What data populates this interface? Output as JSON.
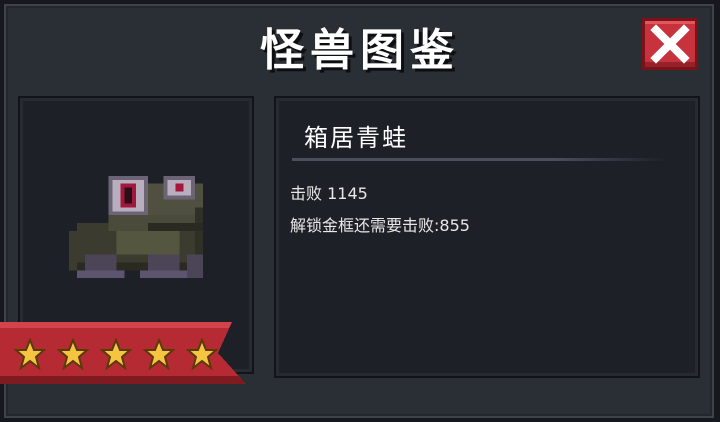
{
  "title": "怪兽图鉴",
  "icons": {
    "close": "close-icon",
    "star": "star-icon",
    "monster": "frog-sprite"
  },
  "monster": {
    "name": "箱居青蛙",
    "defeated_label": "击败",
    "defeated_count": "1145",
    "defeated_text": "击败 1145",
    "unlock_text": "解锁金框还需要击败:855",
    "stars": 5
  },
  "colors": {
    "close_red": "#c8323c",
    "ribbon_red": "#b52a33",
    "star_gold": "#f5c542",
    "panel": "#2a2e35"
  }
}
